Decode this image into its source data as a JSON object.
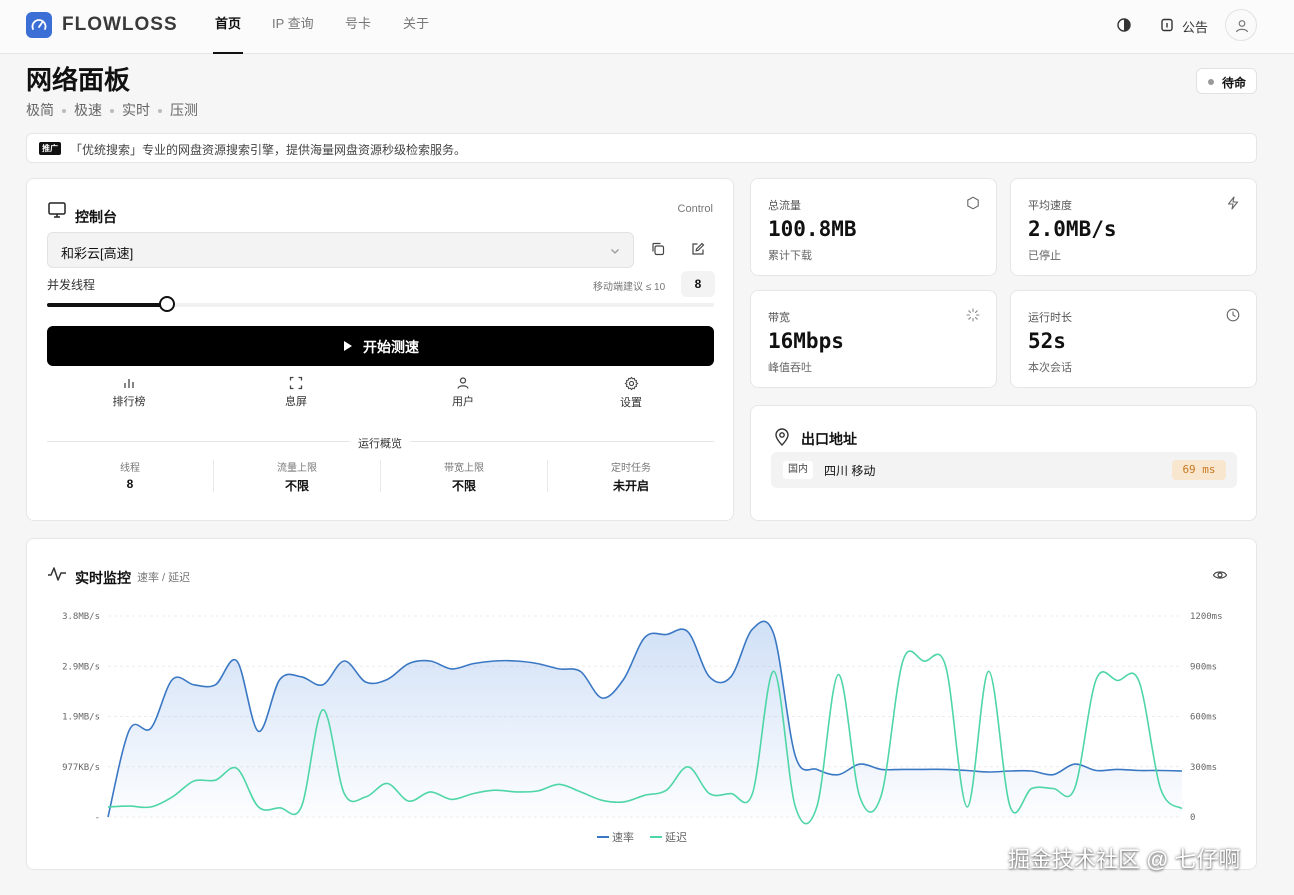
{
  "app": {
    "brand": "FLOWLOSS"
  },
  "nav": {
    "items": [
      "首页",
      "IP 查询",
      "号卡",
      "关于"
    ],
    "active": "首页"
  },
  "header": {
    "notice_label": "公告"
  },
  "page": {
    "title": "网络面板",
    "tags": [
      "极简",
      "极速",
      "实时",
      "压测"
    ],
    "status": "待命"
  },
  "ad": {
    "tag": "推广",
    "text": "「优统搜索」专业的网盘资源搜索引擎，提供海量网盘资源秒级检索服务。"
  },
  "control": {
    "title": "控制台",
    "tag": "Control",
    "node_selected": "和彩云[高速]",
    "threads_label": "并发线程",
    "threads_hint": "移动端建议 ≤ 10",
    "threads_value": "8",
    "threads_level": 0.18,
    "start_label": "开始测速",
    "quick": [
      "排行榜",
      "息屏",
      "用户",
      "设置"
    ],
    "overview_label": "运行概览",
    "overview": [
      {
        "label": "线程",
        "value": "8"
      },
      {
        "label": "流量上限",
        "value": "不限"
      },
      {
        "label": "带宽上限",
        "value": "不限"
      },
      {
        "label": "定时任务",
        "value": "未开启"
      }
    ]
  },
  "metrics": [
    {
      "label": "总流量",
      "value": "100.8MB",
      "sub": "累计下载",
      "icon": "hexagon-icon"
    },
    {
      "label": "平均速度",
      "value": "2.0MB/s",
      "sub": "已停止",
      "icon": "lightning-icon"
    },
    {
      "label": "带宽",
      "value": "16Mbps",
      "sub": "峰值吞吐",
      "icon": "loader-icon"
    },
    {
      "label": "运行时长",
      "value": "52s",
      "sub": "本次会话",
      "icon": "clock-icon"
    }
  ],
  "exit": {
    "title": "出口地址",
    "region": "国内",
    "location": "四川 移动",
    "latency": "69 ms"
  },
  "monitor": {
    "title": "实时监控",
    "subtitle": "速率 / 延迟"
  },
  "colors": {
    "speed": "#3b78c4",
    "latency": "#4fd6a6",
    "latency_badge_bg": "#f8e6cf",
    "latency_badge_fg": "#c9781f"
  },
  "chart_data": {
    "type": "line",
    "x_count": 51,
    "y_left_ticks": [
      "3.8MB/s",
      "2.9MB/s",
      "1.9MB/s",
      "977KB/s",
      "-"
    ],
    "y_right_ticks": [
      "1200ms",
      "900ms",
      "600ms",
      "300ms",
      "0"
    ],
    "ylim_left": [
      0,
      3.8
    ],
    "ylim_right": [
      0,
      1200
    ],
    "series": [
      {
        "name": "速率",
        "axis": "left",
        "values": [
          0,
          1.65,
          1.68,
          2.6,
          2.5,
          2.5,
          2.95,
          1.62,
          2.6,
          2.65,
          2.5,
          2.95,
          2.55,
          2.6,
          2.9,
          2.95,
          2.8,
          2.9,
          2.95,
          2.95,
          2.9,
          2.8,
          2.75,
          2.25,
          2.6,
          3.4,
          3.45,
          3.5,
          2.65,
          2.65,
          3.55,
          3.45,
          1.15,
          0.9,
          0.8,
          1.0,
          0.9,
          0.9,
          0.9,
          0.9,
          0.88,
          0.85,
          0.87,
          0.87,
          0.8,
          1.0,
          0.88,
          0.9,
          0.88,
          0.88,
          0.87
        ]
      },
      {
        "name": "延迟",
        "axis": "right",
        "values": [
          60,
          65,
          60,
          120,
          215,
          220,
          290,
          60,
          55,
          60,
          640,
          140,
          120,
          200,
          95,
          150,
          105,
          140,
          160,
          150,
          155,
          195,
          150,
          100,
          90,
          130,
          160,
          300,
          140,
          140,
          140,
          870,
          60,
          60,
          850,
          120,
          130,
          930,
          930,
          900,
          60,
          870,
          60,
          170,
          170,
          170,
          820,
          815,
          810,
          170,
          50
        ]
      }
    ]
  }
}
